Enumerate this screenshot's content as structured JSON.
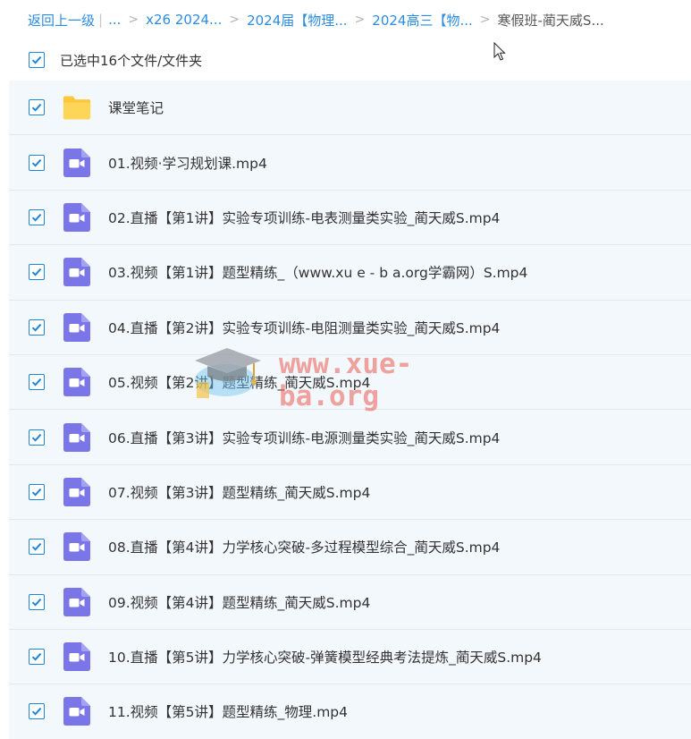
{
  "breadcrumb": {
    "back_label": "返回上一级",
    "pipe": "|",
    "ellipsis": "...",
    "separator": ">",
    "items": [
      {
        "label": "x26 2024..."
      },
      {
        "label": "2024届【物理..."
      },
      {
        "label": "2024高三【物..."
      }
    ],
    "current": "寒假班-蔺天威S..."
  },
  "selection": {
    "checked": true,
    "text": "已选中16个文件/文件夹"
  },
  "files": [
    {
      "name": "课堂笔记",
      "type": "folder",
      "checked": true,
      "icon": "folder-icon"
    },
    {
      "name": "01.视频·学习规划课.mp4",
      "type": "video",
      "checked": true,
      "icon": "video-file-icon"
    },
    {
      "name": "02.直播【第1讲】实验专项训练-电表测量类实验_蔺天威S.mp4",
      "type": "video",
      "checked": true,
      "icon": "video-file-icon"
    },
    {
      "name": "03.视频【第1讲】题型精练_（www.xu e - b a.org学霸网）S.mp4",
      "type": "video",
      "checked": true,
      "icon": "video-file-icon"
    },
    {
      "name": "04.直播【第2讲】实验专项训练-电阻测量类实验_蔺天威S.mp4",
      "type": "video",
      "checked": true,
      "icon": "video-file-icon"
    },
    {
      "name": "05.视频【第2讲】题型精练_蔺天威S.mp4",
      "type": "video",
      "checked": true,
      "icon": "video-file-icon"
    },
    {
      "name": "06.直播【第3讲】实验专项训练-电源测量类实验_蔺天威S.mp4",
      "type": "video",
      "checked": true,
      "icon": "video-file-icon"
    },
    {
      "name": "07.视频【第3讲】题型精练_蔺天威S.mp4",
      "type": "video",
      "checked": true,
      "icon": "video-file-icon"
    },
    {
      "name": "08.直播【第4讲】力学核心突破-多过程模型综合_蔺天威S.mp4",
      "type": "video",
      "checked": true,
      "icon": "video-file-icon"
    },
    {
      "name": "09.视频【第4讲】题型精练_蔺天威S.mp4",
      "type": "video",
      "checked": true,
      "icon": "video-file-icon"
    },
    {
      "name": "10.直播【第5讲】力学核心突破-弹簧模型经典考法提炼_蔺天威S.mp4",
      "type": "video",
      "checked": true,
      "icon": "video-file-icon"
    },
    {
      "name": "11.视频【第5讲】题型精练_物理.mp4",
      "type": "video",
      "checked": true,
      "icon": "video-file-icon"
    }
  ],
  "watermark": {
    "text": "www.xue-ba.org",
    "icon": "graduation-cap-logo"
  },
  "colors": {
    "link": "#2a8ce0",
    "checkbox": "#1f85d8",
    "row_bg": "#f3f8fd",
    "folder": "#fcc73a",
    "video_icon": "#7b76e8"
  }
}
